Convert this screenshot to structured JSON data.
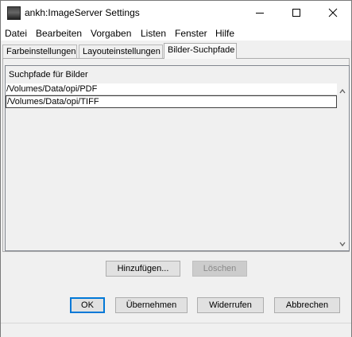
{
  "window": {
    "title": "ankh:ImageServer Settings"
  },
  "menu": [
    "Datei",
    "Bearbeiten",
    "Vorgaben",
    "Listen",
    "Fenster",
    "Hilfe"
  ],
  "tabs": [
    "Farbeinstellungen",
    "Layouteinstellungen",
    "Bilder-Suchpfade"
  ],
  "active_tab": "Bilder-Suchpfade",
  "paths": {
    "header": "Suchpfade für Bilder",
    "items": [
      "/Volumes/Data/opi/PDF",
      "/Volumes/Data/opi/TIFF"
    ],
    "selected": "/Volumes/Data/opi/TIFF"
  },
  "list_buttons": {
    "add": "Hinzufügen...",
    "delete": "Löschen"
  },
  "dialog_buttons": {
    "ok": "OK",
    "apply": "Übernehmen",
    "revert": "Widerrufen",
    "cancel": "Abbrechen"
  },
  "icons": [
    "minimize-icon",
    "maximize-icon",
    "close-icon",
    "scroll-up-icon",
    "scroll-down-icon"
  ]
}
